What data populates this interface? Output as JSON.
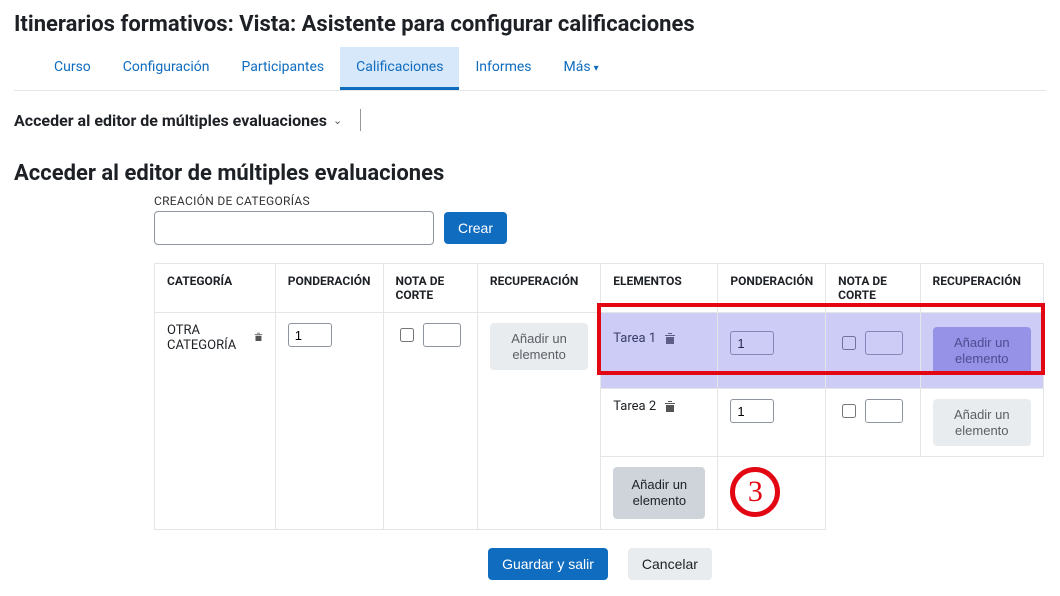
{
  "page_title": "Itinerarios formativos: Vista: Asistente para configurar calificaciones",
  "nav": {
    "tabs": [
      "Curso",
      "Configuración",
      "Participantes",
      "Calificaciones",
      "Informes",
      "Más"
    ],
    "active_index": 3
  },
  "section_switch_label": "Acceder al editor de múltiples evaluaciones",
  "section_heading": "Acceder al editor de múltiples evaluaciones",
  "category_create": {
    "label": "CREACIÓN DE CATEGORÍAS",
    "value": "",
    "button": "Crear"
  },
  "table": {
    "headers": {
      "categoria": "CATEGORÍA",
      "ponderacion": "PONDERACIÓN",
      "nota_corte": "NOTA DE CORTE",
      "recuperacion": "RECUPERACIÓN",
      "elementos": "ELEMENTOS"
    },
    "category_row": {
      "name": "OTRA CATEGORÍA",
      "weight": "1",
      "cut_checked": false,
      "cut_value": "",
      "add_label": "Añadir un elemento"
    },
    "elements": [
      {
        "name": "Tarea 1",
        "weight": "1",
        "cut_checked": false,
        "cut_value": "",
        "add_label": "Añadir un elemento"
      },
      {
        "name": "Tarea 2",
        "weight": "1",
        "cut_checked": false,
        "cut_value": "",
        "add_label": "Añadir un elemento"
      }
    ],
    "add_row_label": "Añadir un elemento"
  },
  "step_badge": "3",
  "footer": {
    "save": "Guardar y salir",
    "cancel": "Cancelar"
  }
}
